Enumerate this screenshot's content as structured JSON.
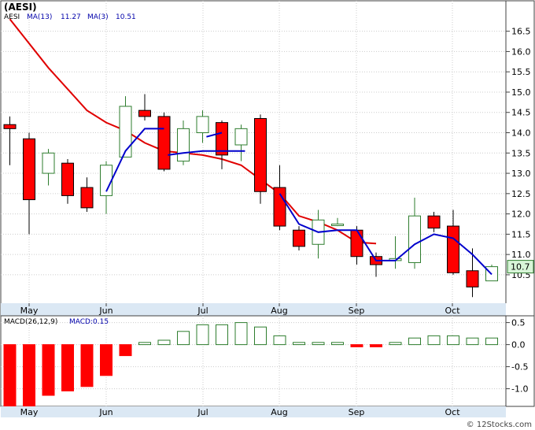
{
  "header": {
    "ticker": "(AESI)",
    "legend_symbol": "AESI",
    "ma13_label": "MA(13)",
    "ma13_value": "11.27",
    "ma3_label": "MA(3)",
    "ma3_value": "10.51",
    "last_price_label": "10.7"
  },
  "macd_panel": {
    "label": "MACD(26,12,9)",
    "value_label": "MACD:0.15"
  },
  "footer": {
    "copyright": "© 12Stocks.com"
  },
  "colors": {
    "up_fill": "#ffffff",
    "up_stroke": "#2e7d2e",
    "down_fill": "#ff0000",
    "ma13": "#e00000",
    "ma3": "#0000cc",
    "ticker_text": "#000000",
    "label_text": "#0000aa",
    "frame": "#404040",
    "grid": "#cccccc",
    "axis_band": "#dbe8f4"
  },
  "chart_data": [
    {
      "type": "candlestick",
      "title": "(AESI)",
      "y_ticks": [
        16.5,
        16.0,
        15.5,
        15.0,
        14.5,
        14.0,
        13.5,
        13.0,
        12.5,
        12.0,
        11.5,
        11.0,
        10.5
      ],
      "ylim": [
        9.8,
        17.25
      ],
      "x_labels": [
        "May",
        "Jun",
        "Jul",
        "Aug",
        "Sep",
        "Oct"
      ],
      "x_label_positions": [
        1,
        6,
        11,
        16,
        20,
        25
      ],
      "candles": [
        {
          "o": 14.2,
          "h": 14.4,
          "l": 13.2,
          "c": 14.1
        },
        {
          "o": 13.85,
          "h": 14.0,
          "l": 11.5,
          "c": 12.35
        },
        {
          "o": 13.0,
          "h": 13.6,
          "l": 12.7,
          "c": 13.5
        },
        {
          "o": 13.25,
          "h": 13.35,
          "l": 12.25,
          "c": 12.45
        },
        {
          "o": 12.65,
          "h": 12.9,
          "l": 12.05,
          "c": 12.15
        },
        {
          "o": 12.45,
          "h": 13.3,
          "l": 12.0,
          "c": 13.2
        },
        {
          "o": 13.4,
          "h": 14.9,
          "l": 13.4,
          "c": 14.65
        },
        {
          "o": 14.55,
          "h": 14.95,
          "l": 14.3,
          "c": 14.4
        },
        {
          "o": 14.4,
          "h": 14.5,
          "l": 13.05,
          "c": 13.1
        },
        {
          "o": 13.3,
          "h": 14.3,
          "l": 13.2,
          "c": 14.1
        },
        {
          "o": 14.0,
          "h": 14.55,
          "l": 13.75,
          "c": 14.4
        },
        {
          "o": 14.25,
          "h": 14.3,
          "l": 13.1,
          "c": 13.45
        },
        {
          "o": 13.7,
          "h": 14.2,
          "l": 13.3,
          "c": 14.1
        },
        {
          "o": 14.35,
          "h": 14.45,
          "l": 12.25,
          "c": 12.55
        },
        {
          "o": 12.65,
          "h": 13.2,
          "l": 11.6,
          "c": 11.7
        },
        {
          "o": 11.6,
          "h": 11.7,
          "l": 11.1,
          "c": 11.2
        },
        {
          "o": 11.25,
          "h": 12.1,
          "l": 10.9,
          "c": 11.85
        },
        {
          "o": 11.75,
          "h": 11.9,
          "l": 11.7,
          "c": 11.75
        },
        {
          "o": 11.6,
          "h": 11.7,
          "l": 10.75,
          "c": 10.95
        },
        {
          "o": 10.95,
          "h": 11.05,
          "l": 10.45,
          "c": 10.75
        },
        {
          "o": 10.85,
          "h": 11.45,
          "l": 10.65,
          "c": 10.9
        },
        {
          "o": 10.8,
          "h": 12.4,
          "l": 10.65,
          "c": 11.95
        },
        {
          "o": 11.95,
          "h": 12.05,
          "l": 11.55,
          "c": 11.65
        },
        {
          "o": 11.7,
          "h": 12.1,
          "l": 10.5,
          "c": 10.55
        },
        {
          "o": 10.6,
          "h": 11.15,
          "l": 9.95,
          "c": 10.2
        },
        {
          "o": 10.35,
          "h": 10.75,
          "l": 10.35,
          "c": 10.7
        }
      ],
      "ma13": {
        "name": "MA(13)",
        "values": [
          16.8,
          16.2,
          15.6,
          15.0,
          14.55,
          14.25,
          14.05,
          13.75,
          13.55,
          13.5,
          13.45,
          13.35,
          13.2,
          12.85,
          12.5,
          11.95,
          11.75,
          11.65,
          11.35,
          11.27
        ],
        "start_index": 0,
        "x_positions": [
          0,
          1,
          2,
          3,
          4,
          5,
          6,
          7,
          8,
          9,
          10,
          11,
          12,
          13,
          14,
          15,
          16,
          17,
          18,
          19,
          20,
          21,
          22,
          23,
          24,
          25
        ]
      },
      "ma13_points": [
        [
          0,
          16.8
        ],
        [
          2,
          15.6
        ],
        [
          4,
          14.55
        ],
        [
          5,
          14.25
        ],
        [
          6,
          14.05
        ],
        [
          7,
          13.75
        ],
        [
          8,
          13.55
        ],
        [
          9,
          13.5
        ],
        [
          10,
          13.45
        ],
        [
          11,
          13.35
        ],
        [
          12,
          13.2
        ],
        [
          13,
          12.85
        ],
        [
          14,
          12.5
        ],
        [
          15,
          11.95
        ],
        [
          16,
          11.8
        ],
        [
          17,
          11.6
        ],
        [
          18,
          11.3
        ],
        [
          19,
          11.27
        ]
      ],
      "ma3_points": [
        [
          5,
          12.55
        ],
        [
          6,
          13.55
        ],
        [
          7,
          14.1
        ],
        [
          8,
          14.1
        ],
        [
          8.2,
          13.45
        ],
        [
          9,
          13.5
        ],
        [
          10,
          13.55
        ],
        [
          11,
          13.55
        ],
        [
          12,
          13.55
        ],
        [
          12.2,
          13.55
        ],
        [
          10.2,
          13.9
        ],
        [
          11,
          14.0
        ],
        [
          14,
          12.5
        ],
        [
          15,
          11.75
        ],
        [
          16,
          11.55
        ],
        [
          17,
          11.6
        ],
        [
          18,
          11.6
        ],
        [
          19,
          10.85
        ],
        [
          20,
          10.85
        ],
        [
          21,
          11.25
        ],
        [
          22,
          11.5
        ],
        [
          23,
          11.4
        ],
        [
          24,
          11.0
        ],
        [
          25,
          10.51
        ]
      ]
    },
    {
      "type": "bar",
      "title": "MACD(26,12,9)",
      "y_ticks": [
        0.5,
        0.0,
        -0.5,
        -1.0
      ],
      "ylim": [
        -1.4,
        0.6
      ],
      "x_labels": [
        "May",
        "Jun",
        "Jul",
        "Aug",
        "Sep",
        "Oct"
      ],
      "values": [
        -1.4,
        -1.4,
        -1.15,
        -1.05,
        -0.95,
        -0.7,
        -0.25,
        0.05,
        0.1,
        0.3,
        0.45,
        0.45,
        0.5,
        0.4,
        0.2,
        0.05,
        0.05,
        0.05,
        -0.05,
        -0.05,
        0.05,
        0.15,
        0.2,
        0.2,
        0.15,
        0.15
      ]
    }
  ]
}
